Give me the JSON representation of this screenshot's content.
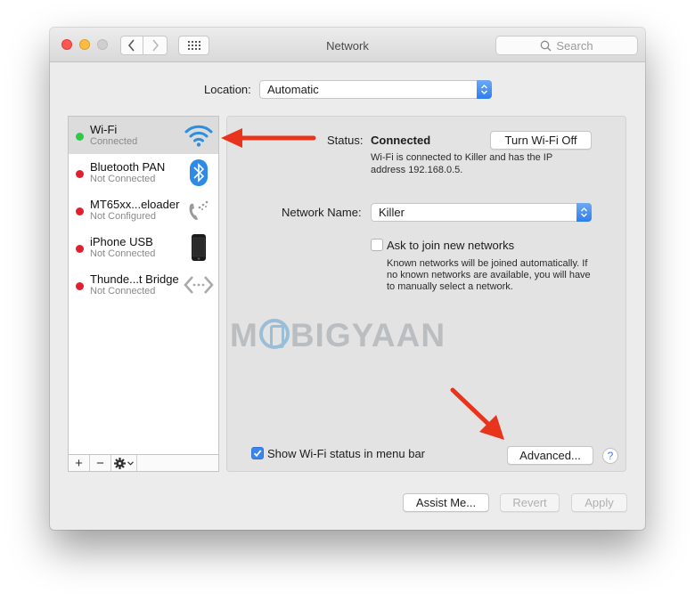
{
  "window": {
    "title": "Network",
    "search_placeholder": "Search",
    "icons": {
      "back": "chevron-left-icon",
      "forward": "chevron-right-icon",
      "grid": "show-all-grid-icon",
      "search": "magnifier-icon"
    }
  },
  "location": {
    "label": "Location:",
    "value": "Automatic"
  },
  "services": [
    {
      "name": "Wi-Fi",
      "status": "Connected",
      "status_color": "#2ec94a",
      "icon": "wifi-icon",
      "selected": true
    },
    {
      "name": "Bluetooth PAN",
      "status": "Not Connected",
      "status_color": "#e0202f",
      "icon": "bluetooth-icon",
      "selected": false
    },
    {
      "name": "MT65xx...eloader",
      "status": "Not Configured",
      "status_color": "#e0202f",
      "icon": "phone-modem-icon",
      "selected": false
    },
    {
      "name": "iPhone USB",
      "status": "Not Connected",
      "status_color": "#e0202f",
      "icon": "iphone-icon",
      "selected": false
    },
    {
      "name": "Thunde...t Bridge",
      "status": "Not Connected",
      "status_color": "#e0202f",
      "icon": "thunderbolt-bridge-icon",
      "selected": false
    }
  ],
  "sidebar_footer": {
    "add": "+",
    "remove": "−",
    "actions": "gear-menu"
  },
  "detail": {
    "status_label": "Status:",
    "status_value": "Connected",
    "turn_off_button": "Turn Wi-Fi Off",
    "status_description_line1": "Wi-Fi is connected to Killer and has the IP",
    "status_description_line2": "address 192.168.0.5.",
    "network_name_label": "Network Name:",
    "network_name_value": "Killer",
    "ask_join_label": "Ask to join new networks",
    "ask_join_checked": false,
    "ask_join_help_line1": "Known networks will be joined automatically. If",
    "ask_join_help_line2": "no known networks are available, you will have",
    "ask_join_help_line3": "to manually select a network.",
    "show_status_label": "Show Wi-Fi status in menu bar",
    "show_status_checked": true,
    "advanced_button": "Advanced...",
    "help_button": "?"
  },
  "footer": {
    "assist_button": "Assist Me...",
    "revert_button": "Revert",
    "apply_button": "Apply"
  },
  "watermark": {
    "left": "M",
    "right": "BIGYAAN"
  },
  "colors": {
    "accent": "#3b86ee",
    "annotation_arrow": "#e8341c",
    "connected": "#2ec94a",
    "disconnected": "#e0202f"
  }
}
